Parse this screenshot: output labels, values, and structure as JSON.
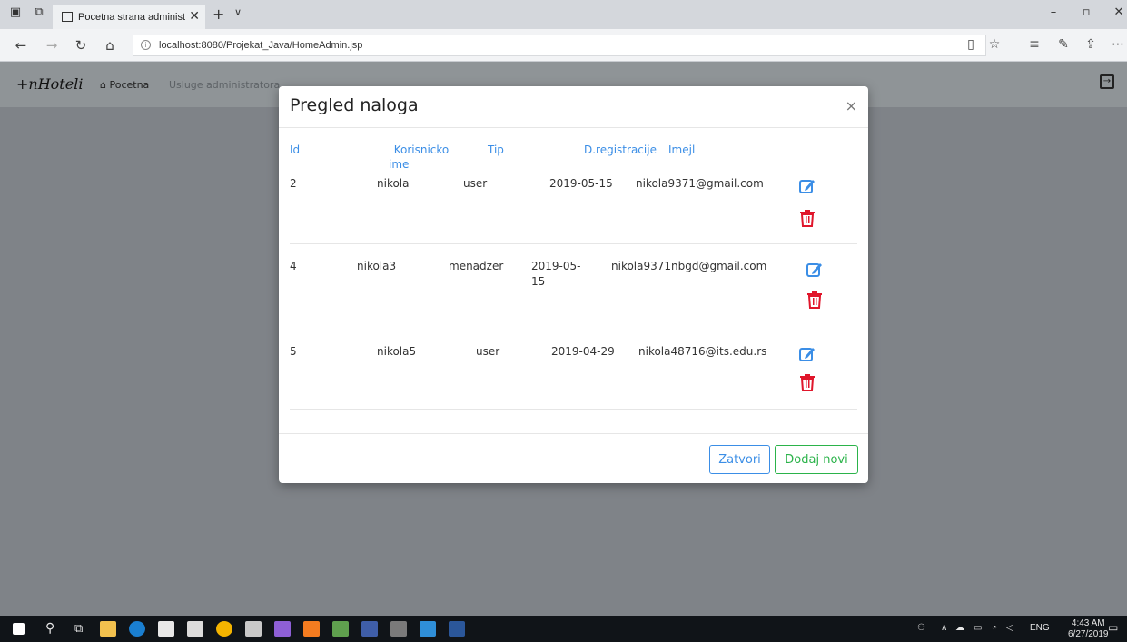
{
  "browser": {
    "tab_title": "Pocetna strana administ",
    "url": "localhost:8080/Projekat_Java/HomeAdmin.jsp"
  },
  "navbar": {
    "brand": "+nHoteli",
    "home": "Pocetna",
    "services": "Usluge administratora"
  },
  "modal": {
    "title": "Pregled naloga",
    "close_glyph": "×",
    "columns": {
      "id": "Id",
      "username_line1": "Korisnicko",
      "username_line2": "ime",
      "type": "Tip",
      "reg_date": "D.registracije",
      "email": "Imejl"
    },
    "rows": [
      {
        "id": "2",
        "username": "nikola",
        "type": "user",
        "date": "2019-05-15",
        "email": "nikola9371@gmail.com"
      },
      {
        "id": "4",
        "username": "nikola3",
        "type": "menadzer",
        "date_line1": "2019-05-",
        "date_line2": "15",
        "email": "nikola9371nbgd@gmail.com"
      },
      {
        "id": "5",
        "username": "nikola5",
        "type": "user",
        "date": "2019-04-29",
        "email": "nikola48716@its.edu.rs"
      }
    ],
    "footer": {
      "close_label": "Zatvori",
      "add_label": "Dodaj novi"
    }
  },
  "taskbar": {
    "lang": "ENG",
    "time": "4:43 AM",
    "date": "6/27/2019"
  },
  "colors": {
    "accent_blue": "#3b8ee6",
    "danger_red": "#e0162b",
    "success_green": "#2bb34a"
  }
}
